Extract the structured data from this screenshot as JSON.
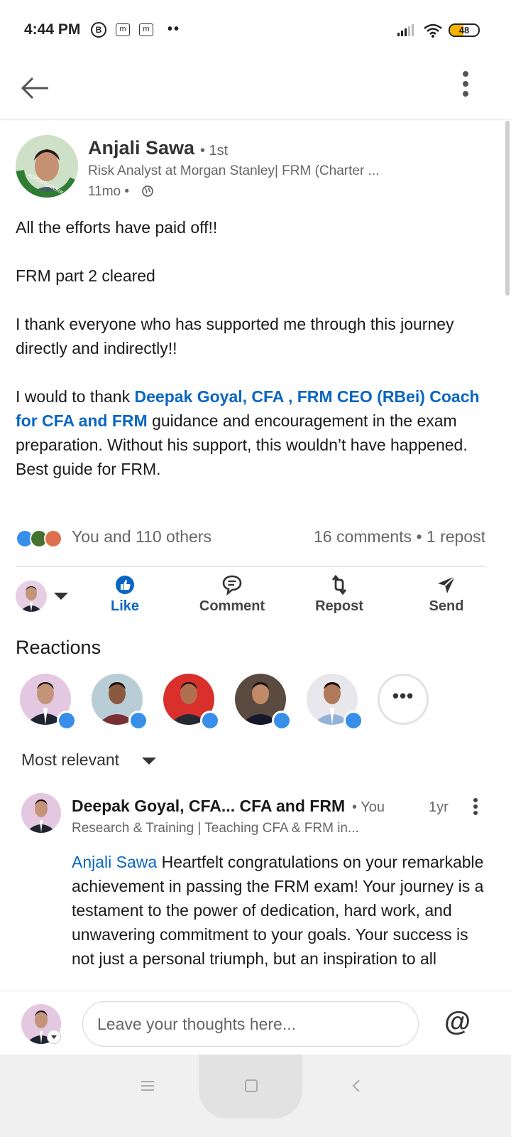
{
  "status_bar": {
    "time": "4:44 PM",
    "icons": [
      "b-circle-icon",
      "m-app-icon",
      "m-app-icon",
      "more-notifications-icon"
    ],
    "b_letter": "B",
    "m_letter": "m",
    "more_dots": "••",
    "battery_level": "48",
    "battery_fraction": 0.48,
    "battery_color": "#f5b400"
  },
  "nav": {
    "back_icon": "arrow-left-icon",
    "more_icon": "vertical-dots-icon"
  },
  "post": {
    "author": {
      "name": "Anjali Sawa",
      "degree": "• 1st",
      "headline": "Risk Analyst at Morgan Stanley| FRM (Charter ...",
      "time": "11mo •",
      "badge_text": "#OPENTOWORK"
    },
    "body": {
      "line1": "All the efforts have paid off!!",
      "line2": "FRM part 2 cleared",
      "line3": "I thank everyone who has supported me through this journey directly and indirectly!!",
      "line4_prefix": "I would to thank ",
      "line4_mention": "Deepak Goyal, CFA , FRM  CEO (RBei) Coach for CFA and FRM",
      "line4_suffix": "  guidance and encouragement in the exam preparation. Without his support, this wouldn’t have happened.",
      "line5": "Best guide for FRM."
    },
    "social": {
      "reactions_summary": "You and 110 others",
      "comments_summary": "16 comments • 1 repost",
      "reaction_icons": [
        "like-reaction-icon",
        "celebrate-reaction-icon",
        "love-reaction-icon"
      ]
    },
    "actions": {
      "like": "Like",
      "comment": "Comment",
      "repost": "Repost",
      "send": "Send"
    }
  },
  "reactions": {
    "heading": "Reactions",
    "more_label": "•••"
  },
  "comments": {
    "sort_label": "Most relevant",
    "items": [
      {
        "name": "Deepak Goyal, CFA... CFA and FRM",
        "degree": "• You",
        "time": "1yr",
        "headline": "Research & Training | Teaching CFA & FRM in...",
        "mention": "Anjali Sawa",
        "text": " Heartfelt congratulations on your remarkable achievement in passing the FRM exam! Your journey is a testament to the power of dedication, hard work, and unwavering commitment to your goals. Your success is not just a personal triumph, but an inspiration to all"
      }
    ]
  },
  "composer": {
    "placeholder": "Leave your thoughts here...",
    "at_label": "@"
  },
  "colors": {
    "brand_blue": "#0a66c2",
    "like_blue": "#378fe9",
    "celebrate_green": "#44712e",
    "love_red": "#df704d"
  }
}
